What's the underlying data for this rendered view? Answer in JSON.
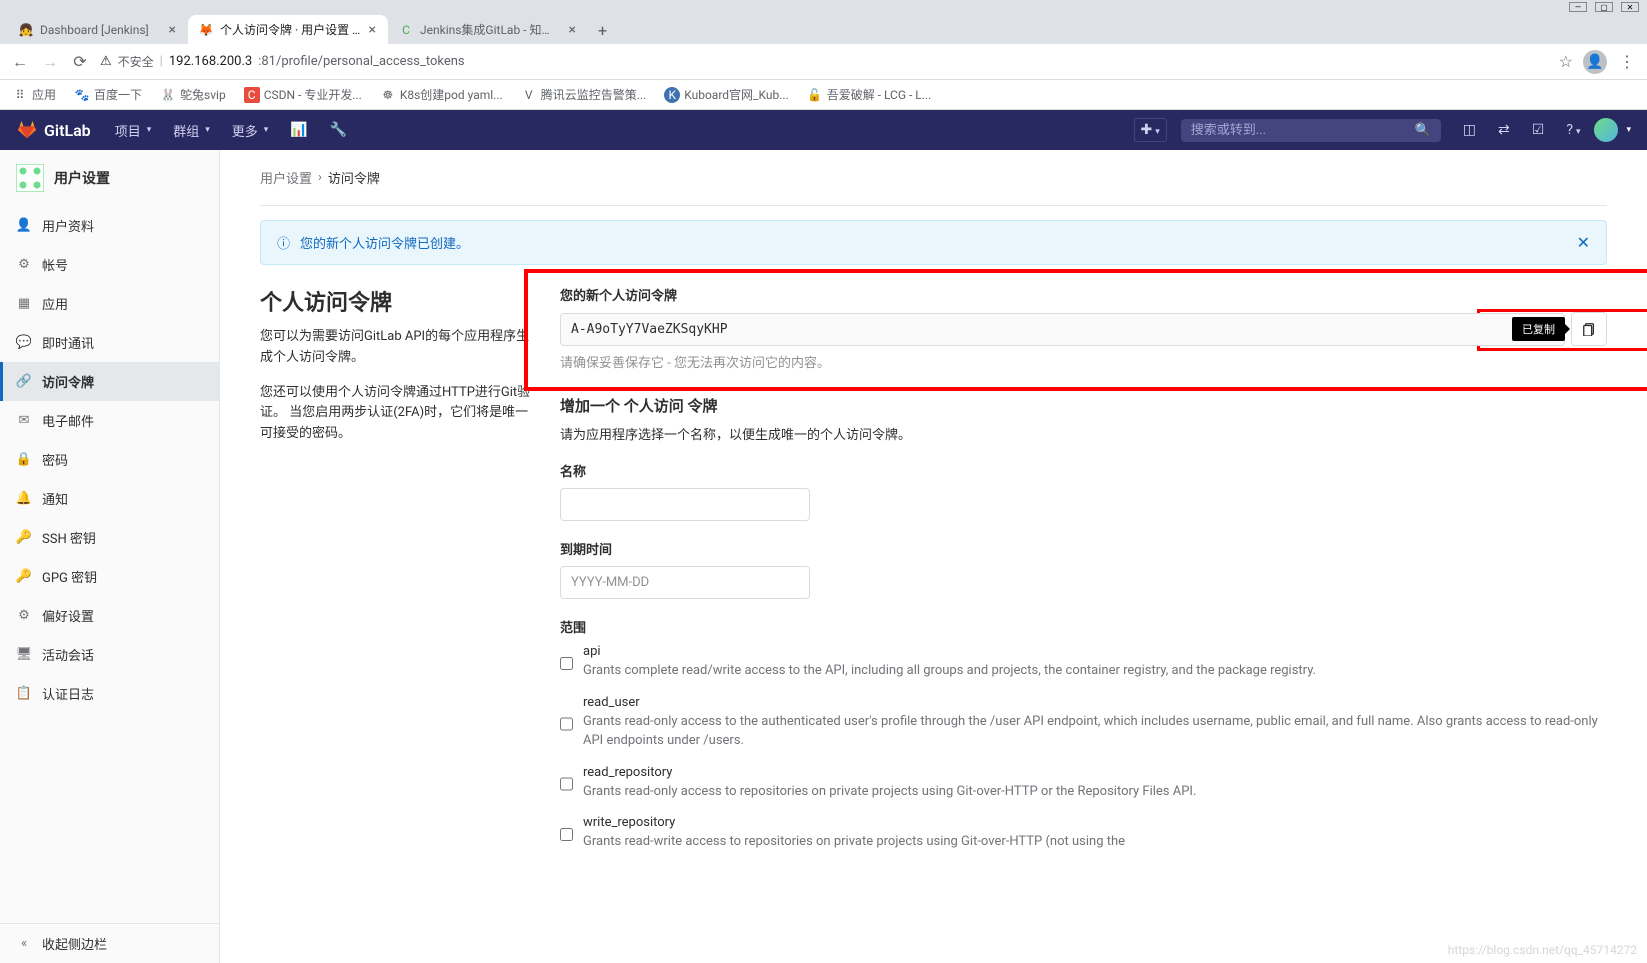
{
  "browser": {
    "tabs": [
      {
        "title": "Dashboard [Jenkins]",
        "favicon": "👧"
      },
      {
        "title": "个人访问令牌 · 用户设置 · GitLa",
        "favicon": "🦊"
      },
      {
        "title": "Jenkins集成GitLab - 知乎 - osc",
        "favicon": "C"
      }
    ],
    "url_warn_icon": "⚠",
    "url_warn": "不安全",
    "url_host": "192.168.200.3",
    "url_path": ":81/profile/personal_access_tokens",
    "bookmarks": [
      {
        "icon": "⠿",
        "label": "应用"
      },
      {
        "icon": "🐾",
        "label": "百度一下"
      },
      {
        "icon": "🐰",
        "label": "鸵兔svip"
      },
      {
        "icon": "C",
        "label": "CSDN - 专业开发..."
      },
      {
        "icon": "☸",
        "label": "K8s创建pod yaml..."
      },
      {
        "icon": "V",
        "label": "腾讯云监控告警策..."
      },
      {
        "icon": "K",
        "label": "Kuboard官网_Kub..."
      },
      {
        "icon": "🔓",
        "label": "吾爱破解 - LCG - L..."
      }
    ]
  },
  "header": {
    "brand": "GitLab",
    "nav": [
      "项目",
      "群组",
      "更多"
    ],
    "search_placeholder": "搜索或转到..."
  },
  "sidebar": {
    "title": "用户设置",
    "items": [
      {
        "label": "用户资料",
        "icon": "👤"
      },
      {
        "label": "帐号",
        "icon": "⚙"
      },
      {
        "label": "应用",
        "icon": "▦"
      },
      {
        "label": "即时通讯",
        "icon": "💬"
      },
      {
        "label": "访问令牌",
        "icon": "🔗",
        "active": true
      },
      {
        "label": "电子邮件",
        "icon": "✉"
      },
      {
        "label": "密码",
        "icon": "🔒"
      },
      {
        "label": "通知",
        "icon": "🔔"
      },
      {
        "label": "SSH 密钥",
        "icon": "🔑"
      },
      {
        "label": "GPG 密钥",
        "icon": "🔑"
      },
      {
        "label": "偏好设置",
        "icon": "⚙"
      },
      {
        "label": "活动会话",
        "icon": "🖥"
      },
      {
        "label": "认证日志",
        "icon": "📋"
      }
    ],
    "collapse": "收起侧边栏"
  },
  "breadcrumb": {
    "root": "用户设置",
    "sep": "›",
    "leaf": "访问令牌"
  },
  "alert": {
    "text": "您的新个人访问令牌已创建。"
  },
  "page": {
    "title": "个人访问令牌",
    "desc1": "您可以为需要访问GitLab API的每个应用程序生成个人访问令牌。",
    "desc2": "您还可以使用个人访问令牌通过HTTP进行Git验证。 当您启用两步认证(2FA)时，它们将是唯一可接受的密码。"
  },
  "token": {
    "label": "您的新个人访问令牌",
    "value": "A-A9oTyY7VaeZKSqyKHP",
    "tooltip": "已复制",
    "hint": "请确保妥善保存它 - 您无法再次访问它的内容。"
  },
  "form": {
    "add_title": "增加一个 个人访问 令牌",
    "add_desc": "请为应用程序选择一个名称，以便生成唯一的个人访问令牌。",
    "name_label": "名称",
    "expiry_label": "到期时间",
    "expiry_placeholder": "YYYY-MM-DD",
    "scopes_label": "范围",
    "scopes": [
      {
        "name": "api",
        "desc": "Grants complete read/write access to the API, including all groups and projects, the container registry, and the package registry."
      },
      {
        "name": "read_user",
        "desc": "Grants read-only access to the authenticated user's profile through the /user API endpoint, which includes username, public email, and full name. Also grants access to read-only API endpoints under /users."
      },
      {
        "name": "read_repository",
        "desc": "Grants read-only access to repositories on private projects using Git-over-HTTP or the Repository Files API."
      },
      {
        "name": "write_repository",
        "desc": "Grants read-write access to repositories on private projects using Git-over-HTTP (not using the"
      }
    ]
  },
  "watermark": "https://blog.csdn.net/qq_45714272"
}
